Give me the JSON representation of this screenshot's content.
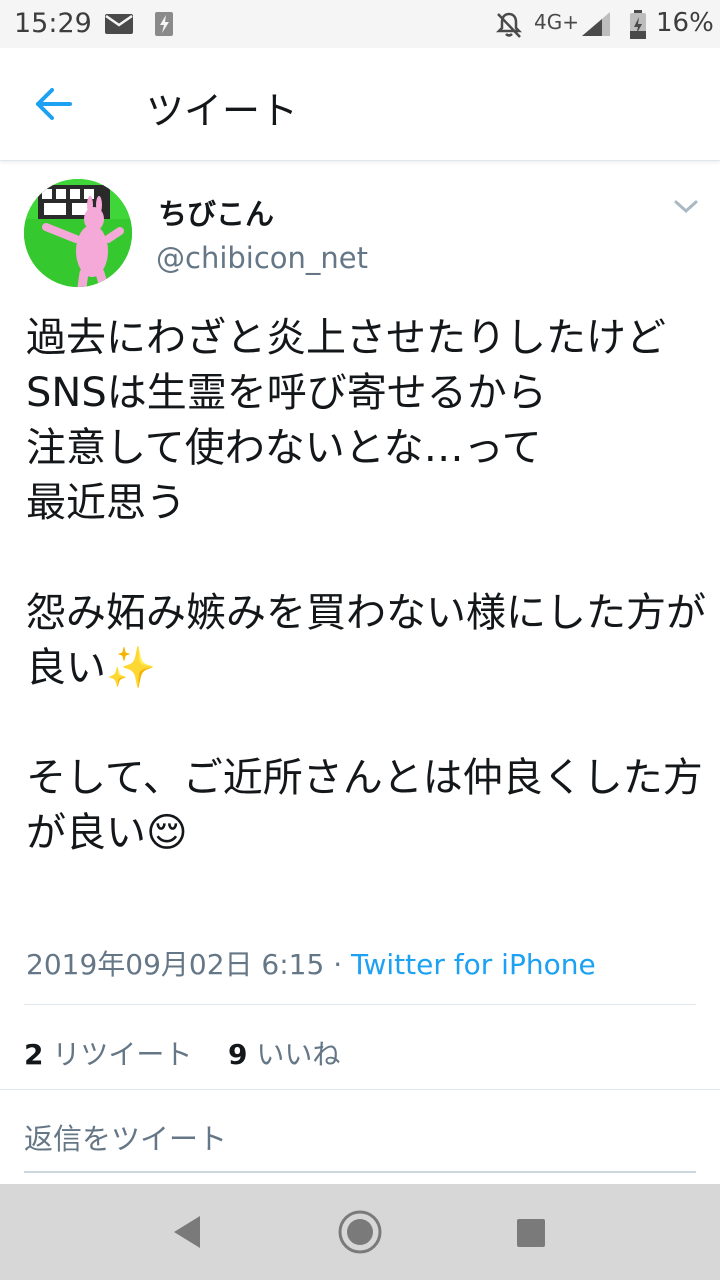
{
  "status_bar": {
    "time": "15:29",
    "network": "4G+",
    "battery": "16%",
    "icons": [
      "mail-icon",
      "flash-icon",
      "mute-icon",
      "signal-icon",
      "battery-icon"
    ]
  },
  "app_bar": {
    "title": "ツイート",
    "back_icon": "arrow-left-icon",
    "accent": "#1da1f2"
  },
  "tweet": {
    "author": {
      "display_name": "ちびこん",
      "handle": "@chibicon_net"
    },
    "text": "過去にわざと炎上させたりしたけど\nSNSは生霊を呼び寄せるから\n注意して使わないとな…って\n最近思う\n\n怨み妬み嫉みを買わない様にした方が良い✨\n\nそして、ご近所さんとは仲良くした方が良い😌",
    "timestamp": "2019年09月02日 6:15",
    "separator": "·",
    "source": "Twitter for iPhone",
    "retweets": {
      "count": "2",
      "label": "リツイート"
    },
    "likes": {
      "count": "9",
      "label": "いいね"
    }
  },
  "reply": {
    "placeholder": "返信をツイート"
  },
  "nav_bar": {
    "icons": [
      "nav-back-icon",
      "nav-home-icon",
      "nav-recents-icon"
    ]
  }
}
